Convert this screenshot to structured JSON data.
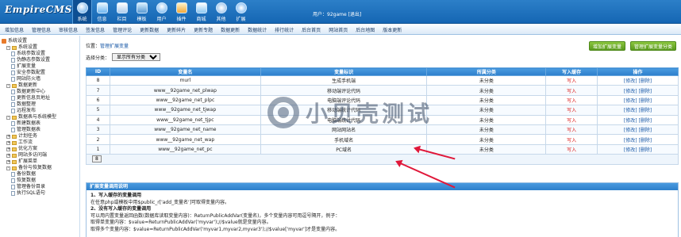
{
  "topbar": {
    "logo": "EmpireCMS",
    "modules": [
      {
        "label": "系统",
        "icon": "system-icon"
      },
      {
        "label": "信息",
        "icon": "info-icon"
      },
      {
        "label": "栏目",
        "icon": "column-icon"
      },
      {
        "label": "模板",
        "icon": "template-icon"
      },
      {
        "label": "用户",
        "icon": "user-icon"
      },
      {
        "label": "插件",
        "icon": "plugin-icon"
      },
      {
        "label": "商城",
        "icon": "shop-icon"
      },
      {
        "label": "其他",
        "icon": "other-icon"
      },
      {
        "label": "扩展",
        "icon": "extend-icon"
      }
    ],
    "user_prefix": "用户：",
    "username": "92game",
    "logout": "[退出]"
  },
  "submenu": [
    "增加信息",
    "管理信息",
    "审核信息",
    "签发信息",
    "管理评论",
    "更新数据",
    "更新碎片",
    "更新专题",
    "数据更新",
    "数据统计",
    "排行统计",
    "后台首页",
    "网站首页",
    "后台地图",
    "版本更新"
  ],
  "sidebar": {
    "items": [
      {
        "label": "系统设置",
        "kind": "root",
        "indent": 0
      },
      {
        "label": "系统设置",
        "kind": "folder",
        "indent": 1,
        "toggle": "-"
      },
      {
        "label": "系统参数设置",
        "kind": "doc",
        "indent": 2
      },
      {
        "label": "伪静态参数设置",
        "kind": "doc",
        "indent": 2
      },
      {
        "label": "扩展变量",
        "kind": "doc",
        "indent": 2
      },
      {
        "label": "安全参数配置",
        "kind": "doc",
        "indent": 2
      },
      {
        "label": "网站防火墙",
        "kind": "doc",
        "indent": 2
      },
      {
        "label": "数据更新",
        "kind": "folder",
        "indent": 1,
        "toggle": "-"
      },
      {
        "label": "数据更新中心",
        "kind": "doc",
        "indent": 2
      },
      {
        "label": "更新信息页地址",
        "kind": "doc",
        "indent": 2
      },
      {
        "label": "数据整理",
        "kind": "doc",
        "indent": 2
      },
      {
        "label": "远程发布",
        "kind": "doc",
        "indent": 2
      },
      {
        "label": "数据表与系统模型",
        "kind": "folder",
        "indent": 1,
        "toggle": "-"
      },
      {
        "label": "新建数据表",
        "kind": "doc",
        "indent": 2
      },
      {
        "label": "管理数据表",
        "kind": "doc",
        "indent": 2
      },
      {
        "label": "计划任务",
        "kind": "folder",
        "indent": 1,
        "toggle": "+"
      },
      {
        "label": "工作流",
        "kind": "folder",
        "indent": 1,
        "toggle": "+"
      },
      {
        "label": "优化方案",
        "kind": "folder",
        "indent": 1,
        "toggle": "+"
      },
      {
        "label": "网站多访问端",
        "kind": "folder",
        "indent": 1,
        "toggle": "+"
      },
      {
        "label": "扩展菜单",
        "kind": "folder",
        "indent": 1,
        "toggle": "+"
      },
      {
        "label": "备份与恢复数据",
        "kind": "folder",
        "indent": 1,
        "toggle": "-"
      },
      {
        "label": "备份数据",
        "kind": "doc",
        "indent": 2
      },
      {
        "label": "恢复数据",
        "kind": "doc",
        "indent": 2
      },
      {
        "label": "管理备份目录",
        "kind": "doc",
        "indent": 2
      },
      {
        "label": "执行SQL语句",
        "kind": "doc",
        "indent": 2
      }
    ]
  },
  "main": {
    "crumb_prefix": "位置：",
    "crumb_link": "管理扩展变量",
    "filter_label": "选择分类：",
    "filter_selected": "显示所有分类",
    "btn_add": "增加扩展变量",
    "btn_manage_class": "管理扩展变量分类",
    "table": {
      "headers": [
        "ID",
        "变量名",
        "变量标识",
        "所属分类",
        "写入缓存",
        "操作"
      ],
      "rows": [
        {
          "id": "8",
          "name": "murl",
          "tag": "生成手机端",
          "class": "未分类",
          "cache": "写入",
          "ops": [
            "[修改]",
            "[删除]"
          ]
        },
        {
          "id": "7",
          "name": "www__92game_net_plwap",
          "tag": "移动端评论代码",
          "class": "未分类",
          "cache": "写入",
          "ops": [
            "[修改]",
            "[删除]"
          ]
        },
        {
          "id": "6",
          "name": "www__92game_net_plpc",
          "tag": "电脑端评论代码",
          "class": "未分类",
          "cache": "写入",
          "ops": [
            "[修改]",
            "[删除]"
          ]
        },
        {
          "id": "5",
          "name": "www__92game_net_tjwap",
          "tag": "移动端统计代码",
          "class": "未分类",
          "cache": "写入",
          "ops": [
            "[修改]",
            "[删除]"
          ]
        },
        {
          "id": "4",
          "name": "www__92game_net_tjpc",
          "tag": "电脑端统计代码",
          "class": "未分类",
          "cache": "写入",
          "ops": [
            "[修改]",
            "[删除]"
          ]
        },
        {
          "id": "3",
          "name": "www__92game_net_name",
          "tag": "网站网站名",
          "class": "未分类",
          "cache": "写入",
          "ops": [
            "[修改]",
            "[删除]"
          ]
        },
        {
          "id": "2",
          "name": "www__92game_net_wap",
          "tag": "手机域名",
          "class": "未分类",
          "cache": "写入",
          "ops": [
            "[修改]",
            "[删除]"
          ]
        },
        {
          "id": "1",
          "name": "www__92game_net_pc",
          "tag": "PC域名",
          "class": "未分类",
          "cache": "写入",
          "ops": [
            "[修改]",
            "[删除]"
          ]
        }
      ],
      "page_button": "8"
    },
    "help": {
      "title": "扩展变量调用说明",
      "lines": [
        {
          "text": "1、写入缓存的变量调用",
          "bold": true
        },
        {
          "text": "在任意php或模板中用$public_r['add_变量名']可取得变量内容。",
          "bold": false
        },
        {
          "text": " ",
          "bold": false
        },
        {
          "text": "2、没有写入缓存的变量调用",
          "bold": true
        },
        {
          "text": "可以用内置变量返回函数(数据库读取变量内容)：ReturnPublicAddVar(变量名)，多个变量内容可用逗号隔开，例子：",
          "bold": false
        },
        {
          "text": "取得单变量内容：$value=ReturnPublicAddVar('myvar');//$value就是变量内容。",
          "bold": false
        },
        {
          "text": "取得多个变量内容：$value=ReturnPublicAddVar('myvar1,myvar2,myvar3');//$value['myvar']才是变量内容。",
          "bold": false
        }
      ]
    }
  },
  "watermark": "小贝壳测试",
  "colors": {
    "topbar": "#1f72bd",
    "table_header": "#3a8ed8",
    "button_green": "#6aaa2a",
    "cache_red": "#dd2222",
    "arrow_red": "#e0183a"
  }
}
